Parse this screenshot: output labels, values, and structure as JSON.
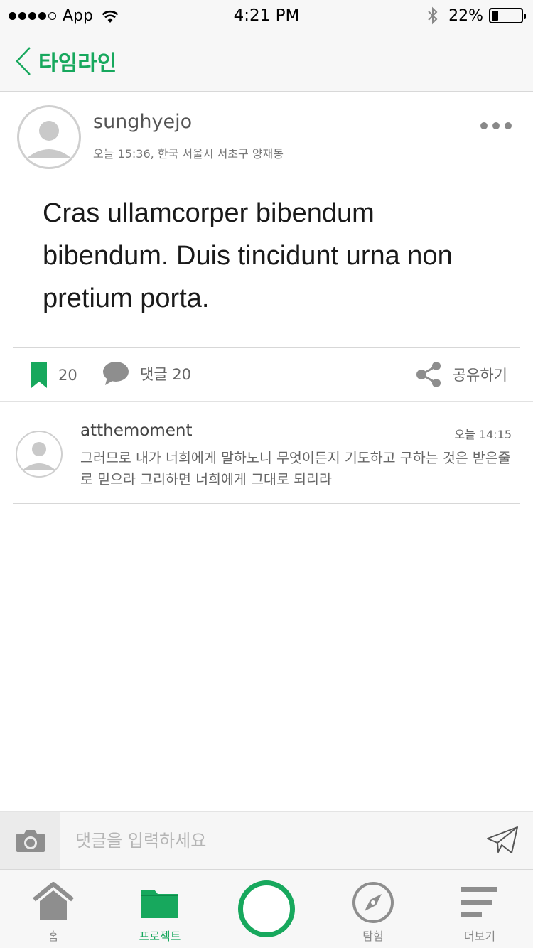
{
  "status_bar": {
    "carrier": "App",
    "time": "4:21 PM",
    "battery_percent": "22%",
    "battery_level": 0.22,
    "signal_bars": 4
  },
  "nav": {
    "back_icon": "chevron-left-icon",
    "title": "타임라인"
  },
  "post": {
    "username": "sunghyejo",
    "meta": "오늘 15:36, 한국 서울시 서초구 양재동",
    "body": "Cras ullamcorper bibendum bibendum. Duis tincidunt urna non pretium porta.",
    "bookmark_count": "20",
    "comment_label": "댓글 20",
    "share_label": "공유하기"
  },
  "comment": {
    "username": "atthemoment",
    "time": "오늘 14:15",
    "text": "그러므로 내가 너희에게 말하노니 무엇이든지 기도하고 구하는 것은 받은줄로 믿으라 그리하면 너희에게 그대로 되리라"
  },
  "composer": {
    "placeholder": "댓글을 입력하세요"
  },
  "tabbar": {
    "home": "홈",
    "project": "프로젝트",
    "explore": "탐험",
    "more": "더보기"
  },
  "colors": {
    "accent": "#17a85d",
    "icon_gray": "#8e8e8e"
  }
}
